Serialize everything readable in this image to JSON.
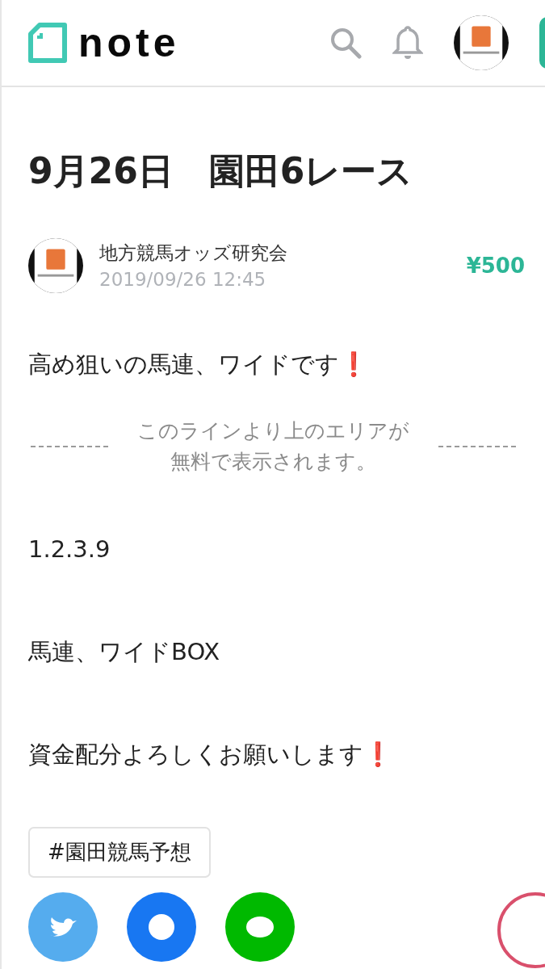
{
  "header": {
    "logo_text": "note"
  },
  "article": {
    "title": "9月26日　園田6レース",
    "author": {
      "name": "地方競馬オッズ研究会",
      "date": "2019/09/26 12:45"
    },
    "price": "¥500",
    "intro": "高め狙いの馬連、ワイドです❗",
    "paywall_lines": [
      "このラインより上のエリアが",
      "無料で表示されます。"
    ],
    "paragraphs": [
      "1.2.3.9",
      "馬連、ワイドBOX",
      "資金配分よろしくお願いします❗"
    ],
    "tags": [
      "#園田競馬予想"
    ]
  },
  "share": [
    {
      "kind": "twitter"
    },
    {
      "kind": "facebook"
    },
    {
      "kind": "line"
    }
  ]
}
